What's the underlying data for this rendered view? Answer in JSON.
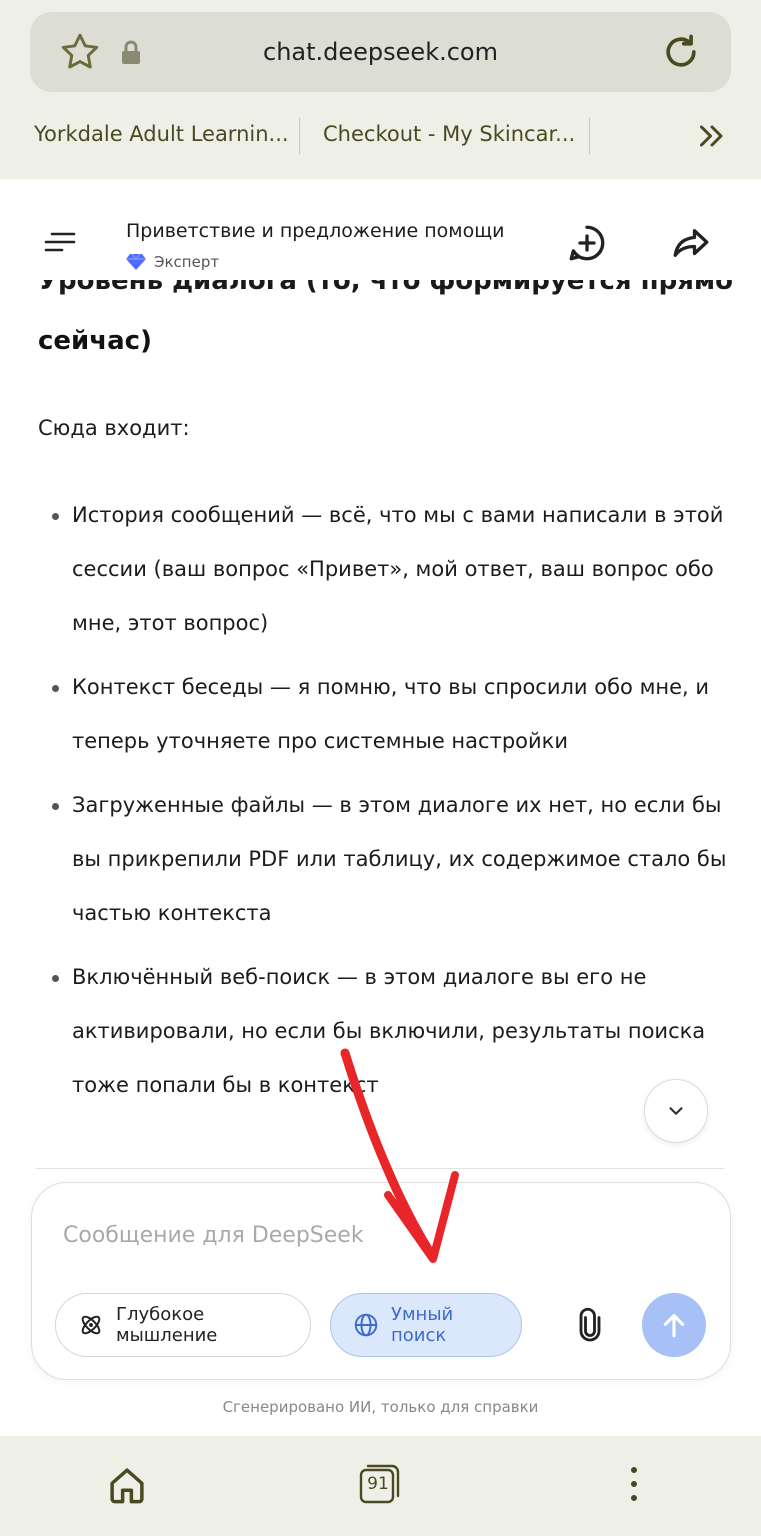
{
  "browser": {
    "url": "chat.deepseek.com",
    "bookmarks": [
      {
        "label": "Yorkdale Adult Learnin..."
      },
      {
        "label": "Checkout - My Skincar..."
      }
    ],
    "tab_count": "91"
  },
  "header": {
    "title": "Приветствие и предложение помощи",
    "model": "Эксперт"
  },
  "content": {
    "heading_partial": "Уровень диалога (то, что формируется прямо",
    "heading_line2": "сейчас)",
    "intro": "Сюда входит:",
    "bullets": [
      "История сообщений — всё, что мы с вами написали в этой сессии (ваш вопрос «Привет», мой ответ, ваш вопрос обо мне, этот вопрос)",
      "Контекст беседы — я помню, что вы спросили обо мне, и теперь уточняете про системные настройки",
      "Загруженные файлы — в этом диалоге их нет, но если бы вы прикрепили PDF или таблицу, их содержимое стало бы частью контекста",
      "Включённый веб-поиск — в этом диалоге вы его не активировали, но если бы включили, результаты поиска тоже попали бы в контекст"
    ]
  },
  "composer": {
    "placeholder": "Сообщение для DeepSeek",
    "deep_think_label": "Глубокое мышление",
    "smart_search_label": "Умный поиск",
    "smart_search_active": true
  },
  "footer": {
    "disclaimer": "Сгенерировано ИИ, только для справки"
  },
  "colors": {
    "accent": "#4d6bfe",
    "send_disabled": "#a7c0f5",
    "browser_bar": "#eeefe6",
    "annotation_arrow": "#e8262a"
  },
  "icons": [
    "star-icon",
    "lock-icon",
    "reload-icon",
    "chevrons-right-icon",
    "menu-icon",
    "gem-icon",
    "new-chat-icon",
    "share-icon",
    "chevron-down-icon",
    "atom-icon",
    "globe-icon",
    "paperclip-icon",
    "arrow-up-icon",
    "home-icon",
    "tabs-icon",
    "more-vertical-icon"
  ]
}
